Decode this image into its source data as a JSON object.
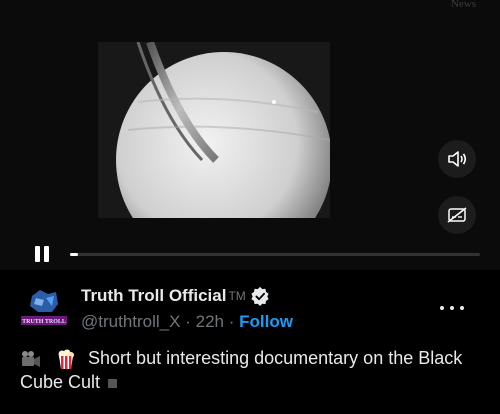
{
  "video": {
    "watermark": "News",
    "progress": 0.02,
    "state": "playing",
    "volume_icon": "volume-icon",
    "captions_icon": "captions-off-icon"
  },
  "tweet": {
    "display_name": "Truth Troll Official",
    "display_name_suffix": "TM",
    "handle": "@truthtroll_X",
    "separator": "·",
    "time": "22h",
    "follow_label": "Follow",
    "avatar_text": "TRUTH TROLL",
    "emojis": [
      "movie-camera-emoji",
      "popcorn-emoji"
    ],
    "text": "Short but interesting documentary on the Black Cube Cult"
  },
  "colors": {
    "accent": "#1d9bf0",
    "text": "#e7e9ea",
    "muted": "#71767b",
    "background": "#000000"
  }
}
